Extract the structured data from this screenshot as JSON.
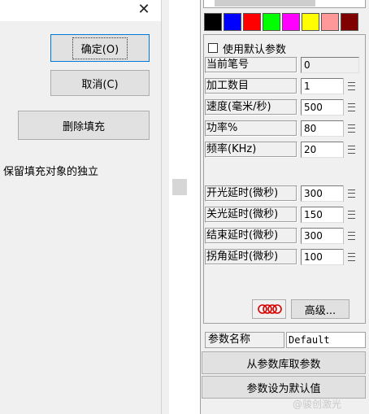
{
  "dialog": {
    "close_icon": "close-icon",
    "ok_label": "确定(O)",
    "cancel_label": "取消(C)",
    "delete_fill_label": "删除填充",
    "note": "保留填充对象的独立"
  },
  "colors": {
    "swatches": [
      "#000000",
      "#0000ff",
      "#ff0000",
      "#00ff00",
      "#ff00ff",
      "#ffff00",
      "#ff9999",
      "#7f0000"
    ]
  },
  "params": {
    "use_default_label": "使用默认参数",
    "use_default_checked": false,
    "rows": [
      {
        "label": "当前笔号",
        "value": "0",
        "readonly": true
      },
      {
        "label": "加工数目",
        "value": "1"
      },
      {
        "label": "速度(毫米/秒)",
        "value": "500"
      },
      {
        "label": "功率%",
        "value": "80"
      },
      {
        "label": "频率(KHz)",
        "value": "20"
      },
      {
        "label": "开光延时(微秒)",
        "value": "300"
      },
      {
        "label": "关光延时(微秒)",
        "value": "150"
      },
      {
        "label": "结束延时(微秒)",
        "value": "300"
      },
      {
        "label": "拐角延时(微秒)",
        "value": "100"
      }
    ],
    "advanced_label": "高级...",
    "param_name_label": "参数名称",
    "param_name_value": "Default",
    "from_lib_label": "从参数库取参数",
    "set_default_label": "参数设为默认值"
  },
  "watermark": "@骏创激光"
}
